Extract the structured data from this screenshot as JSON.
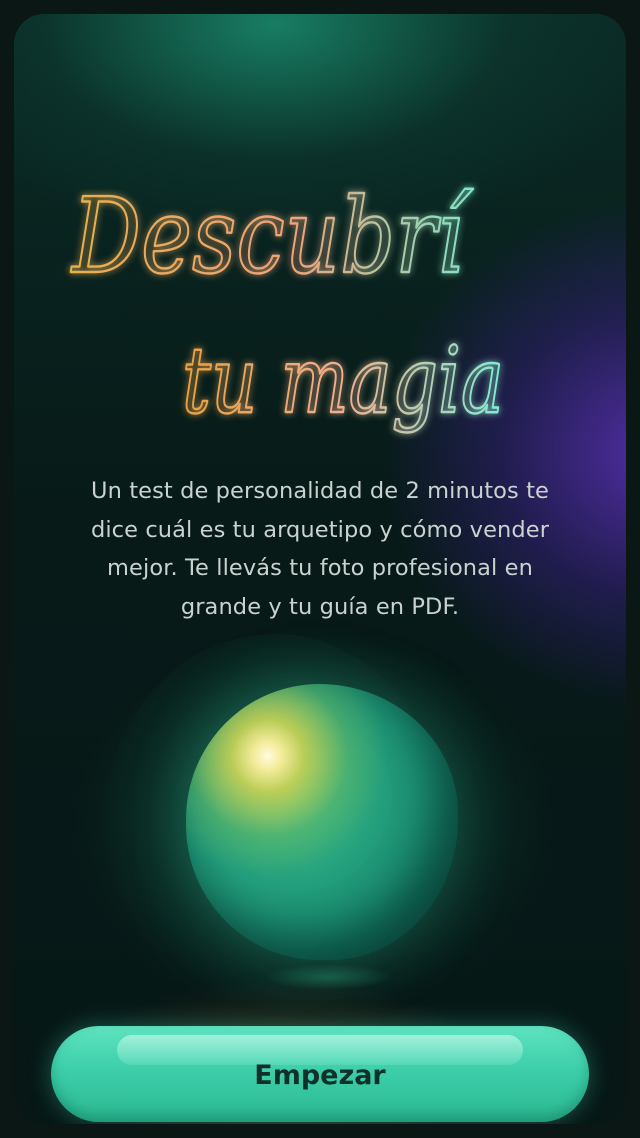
{
  "hero": {
    "title_line1": "Descubrí",
    "title_line2": "tu magia",
    "description": "Un test de personalidad de 2 minutos te dice cuál es tu arquetipo y cómo vender mejor. Te llevás tu foto profesional en grande y tu guía en PDF."
  },
  "cta": {
    "label": "Empezar"
  },
  "colors": {
    "title_gradient_start": "#e8b04a",
    "title_gradient_mid": "#f0a070",
    "title_gradient_end": "#7ee6c8",
    "button": "#3dcfaa",
    "background": "#071a18",
    "accent_purple": "#3b2a8a"
  },
  "icons": {
    "orb": "glowing-sphere"
  }
}
